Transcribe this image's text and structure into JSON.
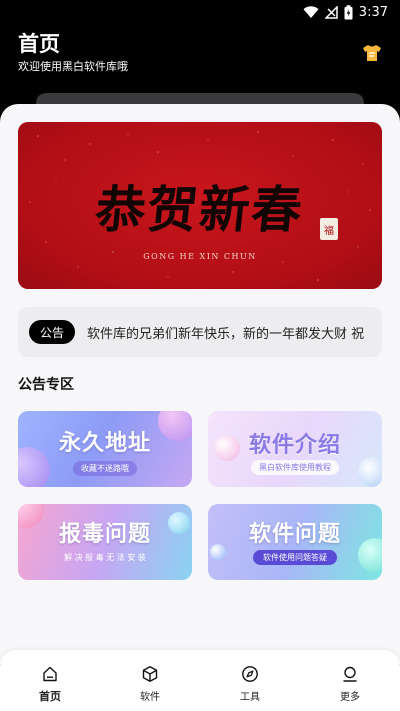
{
  "status_bar": {
    "time": "3:37"
  },
  "header": {
    "title": "首页",
    "subtitle": "欢迎使用黑白软件库哦",
    "action_icon": "tshirt-icon"
  },
  "banner": {
    "title": "恭贺新春",
    "seal": "福",
    "caption": "GONG HE XIN CHUN",
    "colors": {
      "background": "#b10e16",
      "ink": "#120505"
    }
  },
  "notice": {
    "badge": "公告",
    "text": "软件库的兄弟们新年快乐，新的一年都发大财  祝"
  },
  "section": {
    "title": "公告专区"
  },
  "cards": [
    {
      "title": "永久地址",
      "subtitle": "收藏不迷路哦"
    },
    {
      "title": "软件介绍",
      "subtitle": "黑白软件库使用教程"
    },
    {
      "title": "报毒问题",
      "subtitle": "解 决 报 毒 无 法 安 装"
    },
    {
      "title": "软件问题",
      "subtitle": "软件使用问题答疑"
    }
  ],
  "nav": {
    "items": [
      {
        "label": "首页",
        "icon": "home-icon",
        "active": true
      },
      {
        "label": "软件",
        "icon": "cube-icon",
        "active": false
      },
      {
        "label": "工具",
        "icon": "compass-icon",
        "active": false
      },
      {
        "label": "更多",
        "icon": "user-icon",
        "active": false
      }
    ]
  }
}
